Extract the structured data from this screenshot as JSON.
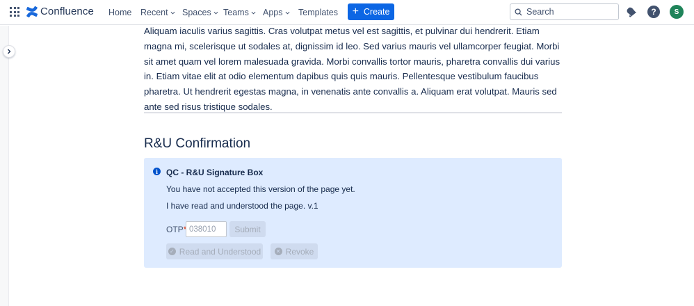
{
  "nav": {
    "logo_text": "Confluence",
    "items": [
      {
        "label": "Home",
        "has_dropdown": false
      },
      {
        "label": "Recent",
        "has_dropdown": true
      },
      {
        "label": "Spaces",
        "has_dropdown": true
      },
      {
        "label": "Teams",
        "has_dropdown": true
      },
      {
        "label": "Apps",
        "has_dropdown": true
      },
      {
        "label": "Templates",
        "has_dropdown": false
      }
    ],
    "create_label": "Create",
    "search_placeholder": "Search",
    "avatar_initial": "S",
    "help_glyph": "?",
    "icons": [
      "app-switcher-icon",
      "confluence-logo-icon",
      "search-icon",
      "notifications-icon",
      "help-icon"
    ],
    "colors": {
      "create": "#0c66e4",
      "avatar": "#1f845a"
    }
  },
  "content": {
    "paragraph": "Aliquam iaculis varius sagittis. Cras volutpat metus vel est sagittis, et pulvinar dui hendrerit. Etiam magna mi, scelerisque ut sodales at, dignissim id leo. Sed varius mauris vel ullamcorper feugiat. Morbi sit amet quam vel lorem malesuada gravida. Morbi convallis tortor mauris, pharetra convallis dui varius in. Etiam vitae elit at odio elementum dapibus quis quis mauris. Pellentesque vestibulum faucibus pharetra. Ut hendrerit egestas magna, in venenatis ante convallis a. Aliquam erat volutpat. Mauris sed ante sed risus tristique sodales.",
    "heading": "R&U Confirmation"
  },
  "panel": {
    "title": "QC - R&U Signature Box",
    "status_text": "You have not accepted this version of the page yet.",
    "statement": "I have read and understood the page. v.1",
    "otp_label": "OTP",
    "otp_required_mark": "*",
    "otp_placeholder": "038010",
    "submit_label": "Submit",
    "read_label": "Read and Understood",
    "revoke_label": "Revoke",
    "colors": {
      "background": "#deebff",
      "info": "#0052cc"
    }
  }
}
